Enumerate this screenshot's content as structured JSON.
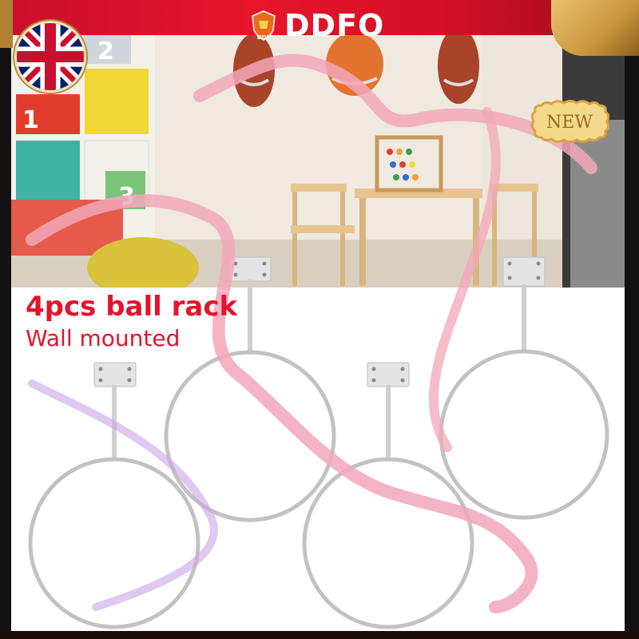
{
  "brand": {
    "name": "DDFO",
    "badge_label": "DDF"
  },
  "badges": {
    "new_label": "NEW"
  },
  "product": {
    "title": "4pcs ball rack",
    "subtitle": "Wall mounted",
    "quantity": 4
  },
  "scene": {
    "shelf_numbers": [
      "1",
      "2",
      "3"
    ]
  },
  "icons": [
    "uk-flag-icon",
    "brand-shield-icon",
    "new-badge-icon"
  ],
  "colors": {
    "accent_red": "#e3142b",
    "gold": "#c9963c",
    "ribbon_pink": "#f2a7b8",
    "rack_metal": "#b9b9b9"
  }
}
